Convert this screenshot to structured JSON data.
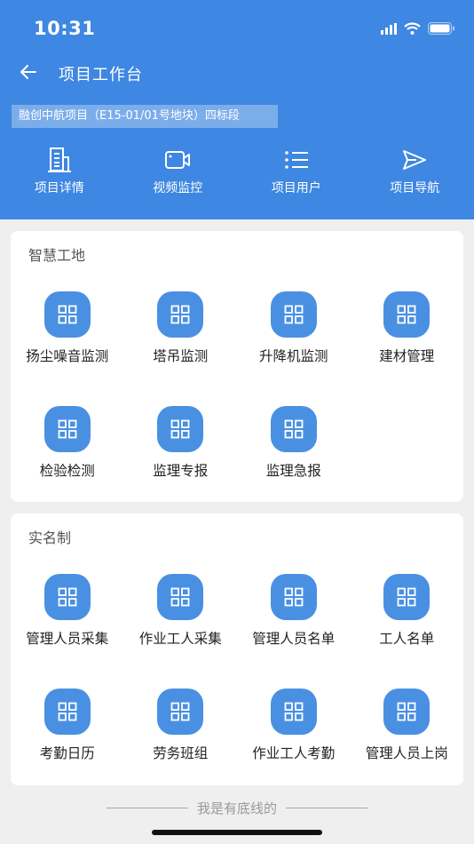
{
  "status_bar": {
    "time": "10:31"
  },
  "nav": {
    "title": "项目工作台"
  },
  "project": {
    "name": "融创中航项目（E15-01/01号地块）四标段"
  },
  "quick_actions": [
    {
      "label": "项目详情",
      "icon": "building-icon"
    },
    {
      "label": "视频监控",
      "icon": "video-camera-icon"
    },
    {
      "label": "项目用户",
      "icon": "list-icon"
    },
    {
      "label": "项目导航",
      "icon": "navigation-send-icon"
    }
  ],
  "sections": [
    {
      "title": "智慧工地",
      "items": [
        {
          "label": "扬尘噪音监测"
        },
        {
          "label": "塔吊监测"
        },
        {
          "label": "升降机监测"
        },
        {
          "label": "建材管理"
        },
        {
          "label": "检验检测"
        },
        {
          "label": "监理专报"
        },
        {
          "label": "监理急报"
        }
      ]
    },
    {
      "title": "实名制",
      "items": [
        {
          "label": "管理人员采集"
        },
        {
          "label": "作业工人采集"
        },
        {
          "label": "管理人员名单"
        },
        {
          "label": "工人名单"
        },
        {
          "label": "考勤日历"
        },
        {
          "label": "劳务班组"
        },
        {
          "label": "作业工人考勤"
        },
        {
          "label": "管理人员上岗"
        }
      ]
    }
  ],
  "footer": {
    "text": "我是有底线的"
  },
  "colors": {
    "primary": "#3e87e2",
    "tile": "#4a90e2",
    "background": "#efefef"
  }
}
